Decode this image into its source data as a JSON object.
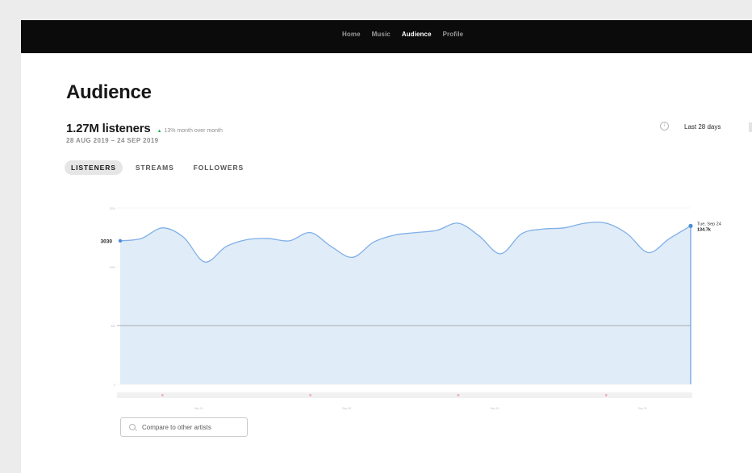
{
  "nav": {
    "items": [
      {
        "label": "Home",
        "active": false
      },
      {
        "label": "Music",
        "active": false
      },
      {
        "label": "Audience",
        "active": true
      },
      {
        "label": "Profile",
        "active": false
      }
    ]
  },
  "page": {
    "title": "Audience",
    "listeners_label": "1.27M listeners",
    "change_arrow": "▲",
    "change_text": "13% month over month",
    "date_range": "28 AUG 2019 – 24 SEP 2019",
    "period_select": "Last 28 days"
  },
  "tabs": [
    {
      "label": "LISTENERS",
      "active": true
    },
    {
      "label": "STREAMS",
      "active": false
    },
    {
      "label": "FOLLOWERS",
      "active": false
    }
  ],
  "chart_data": {
    "type": "area",
    "y_tick_labels": [
      "150k",
      "100k",
      "50k",
      "0"
    ],
    "ylim": [
      0,
      150000
    ],
    "series": [
      {
        "values": [
          122000,
          124000,
          133000,
          125000,
          104000,
          117000,
          123000,
          124000,
          122000,
          129000,
          117000,
          108000,
          121000,
          127000,
          129000,
          131000,
          137000,
          126000,
          111000,
          128000,
          132000,
          133000,
          137000,
          137000,
          128000,
          112000,
          124000,
          134700
        ]
      }
    ],
    "start_marker_label": "3030",
    "tooltip": {
      "date": "Tue, Sep 24",
      "value": "134.7k"
    },
    "x_tick_labels": [
      "Sep 01",
      "Sep 08",
      "Sep 15",
      "Sep 22"
    ],
    "colors": {
      "line": "#7fb0e8",
      "fill": "#ddeaf6",
      "marker": "#f0a6b8",
      "point": "#4c8fd8"
    }
  },
  "compare": {
    "label": "Compare to other artists"
  }
}
